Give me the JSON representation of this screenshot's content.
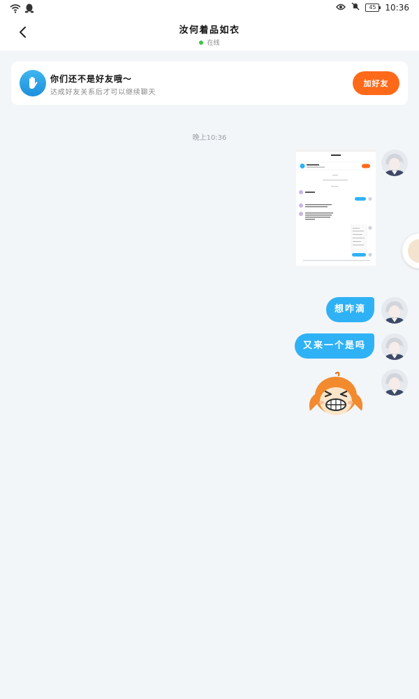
{
  "status_bar": {
    "battery": "45",
    "time": "10:36"
  },
  "header": {
    "title": "汝何着品如衣",
    "status": "在线"
  },
  "banner": {
    "title": "你们还不是好友哦～",
    "subtitle": "达成好友关系后才可以继续聊天",
    "button_label": "加好友"
  },
  "chat": {
    "timestamp": "晚上10:36",
    "messages": [
      {
        "type": "image",
        "content": "screenshot"
      },
      {
        "type": "text",
        "text": "想咋滴"
      },
      {
        "type": "text",
        "text": "又来一个是吗"
      },
      {
        "type": "sticker",
        "content": "grimacing-face-sticker"
      }
    ]
  },
  "colors": {
    "accent_blue": "#2fb2f5",
    "add_friend_orange": "#ff6a1a",
    "online_green": "#3fc34a",
    "background": "#f3f6f9"
  },
  "icons": [
    "wifi-icon",
    "qq-penguin-icon",
    "eye-icon",
    "mute-bell-icon",
    "battery-icon",
    "back-arrow-icon",
    "wave-hand-icon"
  ]
}
